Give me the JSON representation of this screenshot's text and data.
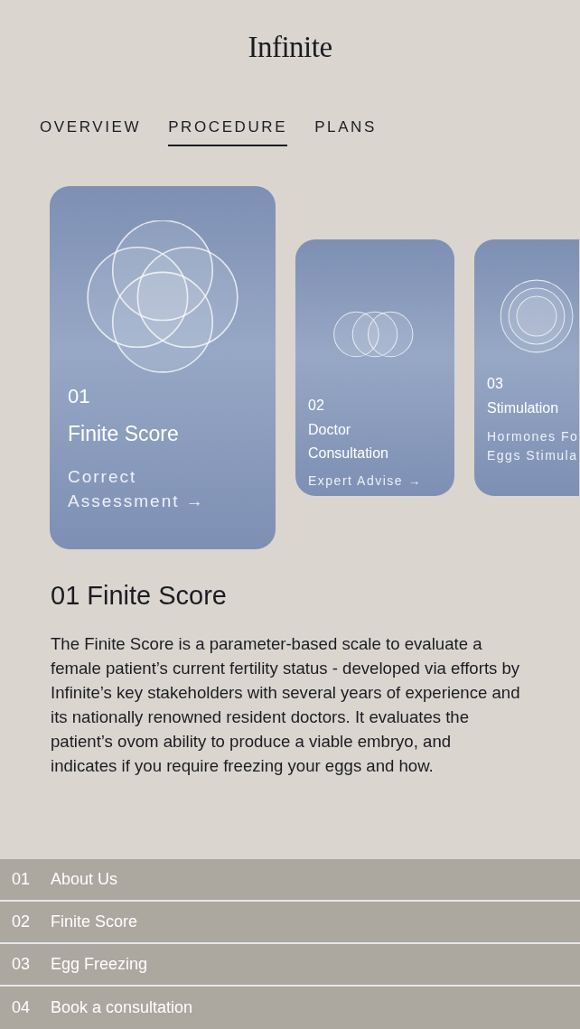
{
  "header": {
    "logo": "Infinite"
  },
  "tabs": [
    {
      "label": "OVERVIEW",
      "selected": false
    },
    {
      "label": "PROCEDURE",
      "selected": true
    },
    {
      "label": "PLANS",
      "selected": false
    }
  ],
  "cards": [
    {
      "kind": "venn4",
      "number": "01",
      "title": [
        "Finite Score"
      ],
      "link": [
        "Correct",
        "Assessment →"
      ],
      "selected": true
    },
    {
      "kind": "venn3",
      "number": "02",
      "title": [
        "Doctor",
        "Consultation"
      ],
      "link": [
        "Expert Advise →"
      ],
      "selected": false
    },
    {
      "kind": "rings",
      "number": "03",
      "title": [
        "Stimulation"
      ],
      "link": [
        "Hormones Fo",
        "Eggs Stimula"
      ],
      "selected": false
    }
  ],
  "detail": {
    "number": "01",
    "title": "Finite Score",
    "body": "The Finite Score is a parameter-based scale to evaluate a female patient’s current fertility status - developed via efforts by Infinite’s key stakeholders with several years of experience and its nationally renowned resident doctors. It evaluates the patient’s ovom ability to produce a viable embryo, and indicates if you require freezing your eggs and how."
  },
  "menu": [
    {
      "number": "01",
      "label": "About Us"
    },
    {
      "number": "02",
      "label": "Finite Score"
    },
    {
      "number": "03",
      "label": "Egg Freezing"
    },
    {
      "number": "04",
      "label": "Book a consultation"
    }
  ]
}
